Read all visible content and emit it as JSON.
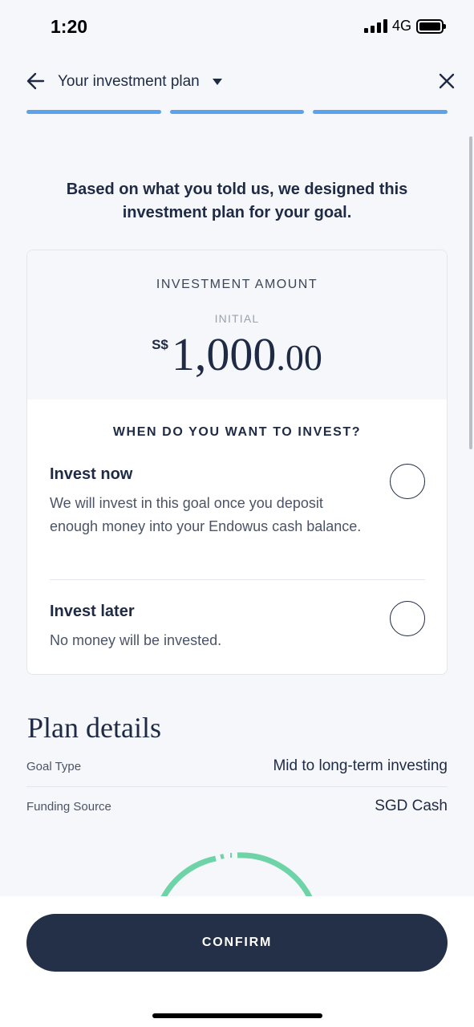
{
  "status": {
    "time": "1:20",
    "network": "4G"
  },
  "header": {
    "title": "Your investment plan"
  },
  "intro": "Based on what you told us, we designed this investment plan for your goal.",
  "investment": {
    "label": "INVESTMENT AMOUNT",
    "sublabel": "INITIAL",
    "currency": "S$",
    "amount_main": "1,000",
    "amount_cents": ".00"
  },
  "when": {
    "heading": "WHEN DO YOU WANT TO INVEST?",
    "options": [
      {
        "title": "Invest now",
        "desc": "We will invest in this goal once you deposit enough money into your Endowus cash balance.",
        "selected": false
      },
      {
        "title": "Invest later",
        "desc": "No money will be invested.",
        "selected": false
      }
    ]
  },
  "plan": {
    "heading": "Plan details",
    "rows": [
      {
        "label": "Goal Type",
        "value": "Mid to long-term investing"
      },
      {
        "label": "Funding Source",
        "value": "SGD Cash"
      }
    ]
  },
  "footer": {
    "confirm_label": "CONFIRM"
  },
  "colors": {
    "accent": "#5aa3ea",
    "primary": "#233047",
    "gauge": "#6fd3a8"
  },
  "icons": [
    "back-arrow-icon",
    "caret-down-icon",
    "close-icon",
    "signal-icon",
    "battery-icon"
  ]
}
